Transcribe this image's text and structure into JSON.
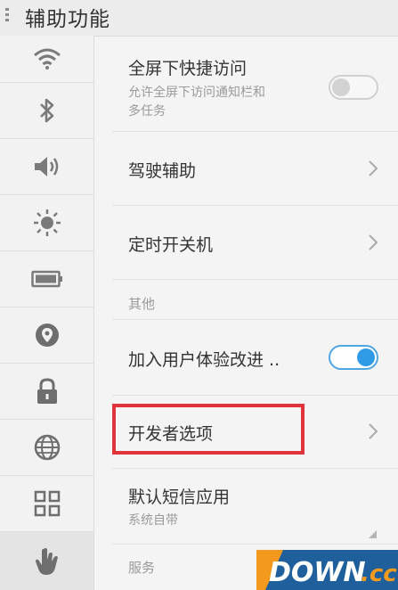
{
  "header": {
    "title": "辅助功能"
  },
  "sidebar": {
    "items": [
      {
        "icon": "wifi-icon"
      },
      {
        "icon": "bluetooth-icon"
      },
      {
        "icon": "volume-icon"
      },
      {
        "icon": "brightness-icon"
      },
      {
        "icon": "battery-icon"
      },
      {
        "icon": "location-icon"
      },
      {
        "icon": "lock-icon"
      },
      {
        "icon": "globe-icon"
      },
      {
        "icon": "apps-grid-icon"
      },
      {
        "icon": "hand-gesture-icon",
        "active": true
      }
    ]
  },
  "main": {
    "fullscreen_access": {
      "label": "全屏下快捷访问",
      "sub_line1": "允许全屏下访问通知栏和",
      "sub_line2": "多任务",
      "enabled": false
    },
    "driving_assist": {
      "label": "驾驶辅助"
    },
    "scheduled_power": {
      "label": "定时开关机"
    },
    "section_other": "其他",
    "user_experience": {
      "label": "加入用户体验改进 ..",
      "enabled": true
    },
    "developer_options": {
      "label": "开发者选项"
    },
    "default_sms": {
      "label": "默认短信应用",
      "sub": "系统自带"
    },
    "section_services": "服务"
  },
  "watermark": {
    "text": "DOWN.cc"
  },
  "colors": {
    "toggle_on": "#2f9ae6",
    "highlight_border": "#e0343a",
    "watermark_bg": "#1e5f9c"
  }
}
